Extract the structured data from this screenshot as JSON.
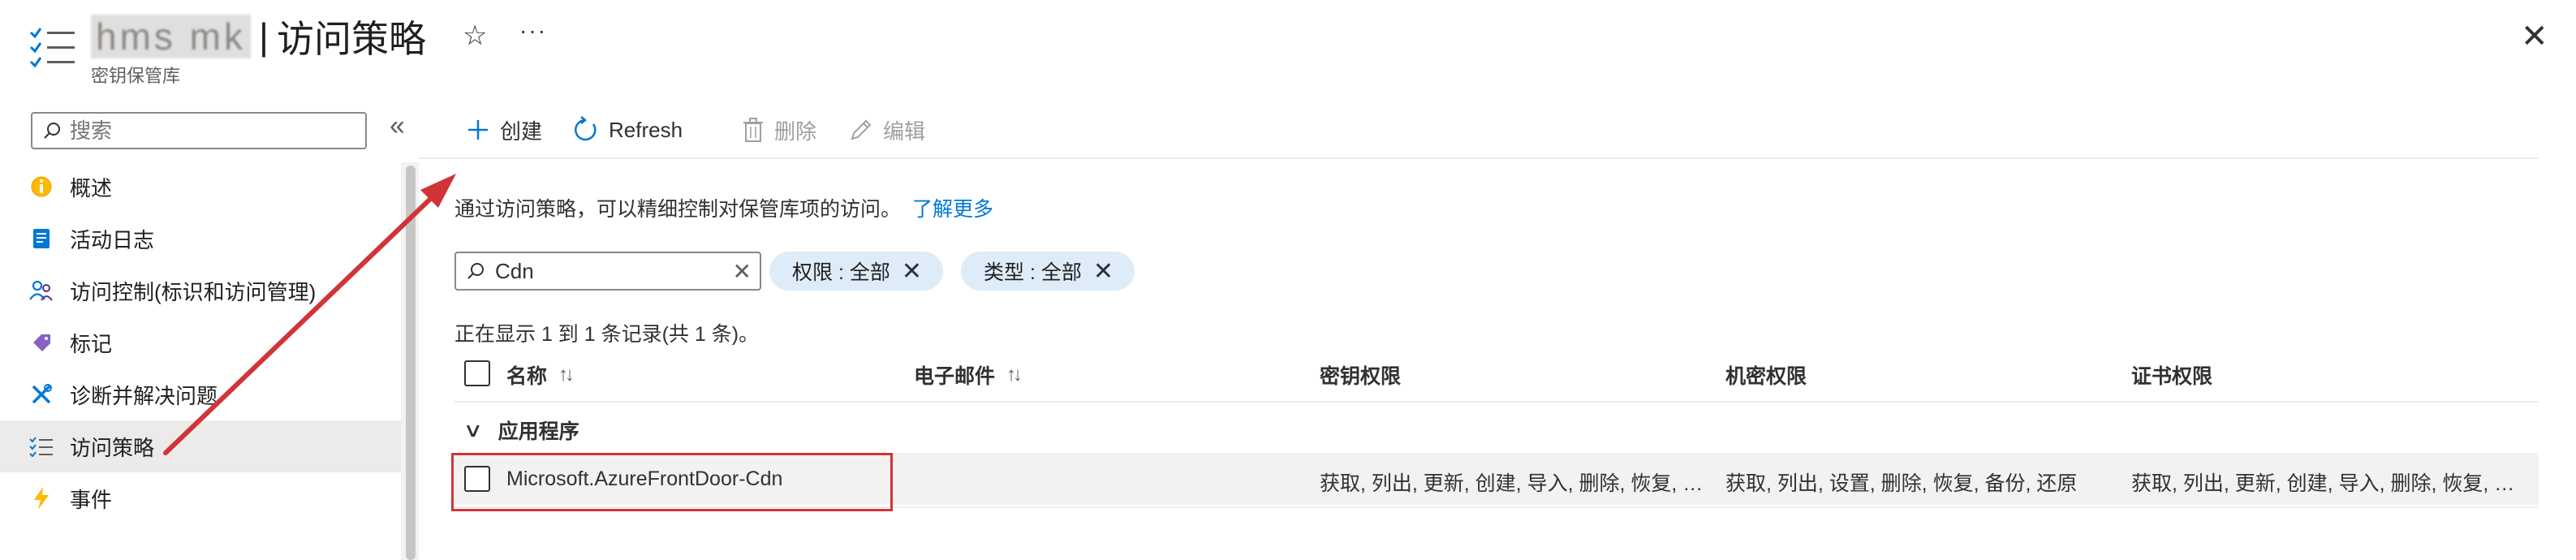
{
  "header": {
    "resource_name": "hms mk",
    "separator": "|",
    "page_title": "访问策略",
    "subtitle": "密钥保管库",
    "star_glyph": "☆",
    "more_glyph": "···",
    "close_glyph": "✕"
  },
  "sidebar": {
    "search_placeholder": "搜索",
    "collapse_glyph": "«",
    "items": [
      {
        "label": "概述",
        "icon": "overview-icon"
      },
      {
        "label": "活动日志",
        "icon": "activity-log-icon"
      },
      {
        "label": "访问控制(标识和访问管理)",
        "icon": "people-icon"
      },
      {
        "label": "标记",
        "icon": "tag-icon"
      },
      {
        "label": "诊断并解决问题",
        "icon": "wrench-icon"
      },
      {
        "label": "访问策略",
        "icon": "list-check-icon",
        "active": true
      },
      {
        "label": "事件",
        "icon": "lightning-icon"
      }
    ]
  },
  "toolbar": {
    "create": "创建",
    "refresh": "Refresh",
    "delete": "删除",
    "edit": "编辑"
  },
  "description": {
    "text": "通过访问策略，可以精细控制对保管库项的访问。",
    "link": "了解更多"
  },
  "filter": {
    "value": "Cdn",
    "clear_glyph": "✕",
    "pills": [
      {
        "label": "权限 : 全部"
      },
      {
        "label": "类型 : 全部"
      }
    ],
    "pill_close_glyph": "✕"
  },
  "result_count": "正在显示 1 到 1 条记录(共 1 条)。",
  "table": {
    "columns": {
      "name": "名称",
      "email": "电子邮件",
      "key_perms": "密钥权限",
      "secret_perms": "机密权限",
      "cert_perms": "证书权限"
    },
    "sort_glyph": "↑↓",
    "group_label": "应用程序",
    "group_chevron": "∨",
    "rows": [
      {
        "name": "Microsoft.AzureFrontDoor-Cdn",
        "email": "",
        "key_perms": "获取, 列出, 更新, 创建, 导入, 删除, 恢复, …",
        "secret_perms": "获取, 列出, 设置, 删除, 恢复, 备份, 还原",
        "cert_perms": "获取, 列出, 更新, 创建, 导入, 删除, 恢复, …"
      }
    ]
  },
  "colors": {
    "accent": "#0078d4",
    "annotation_red": "#d13438",
    "selected_bg": "#edebe9",
    "pill_bg": "#deecf9"
  }
}
